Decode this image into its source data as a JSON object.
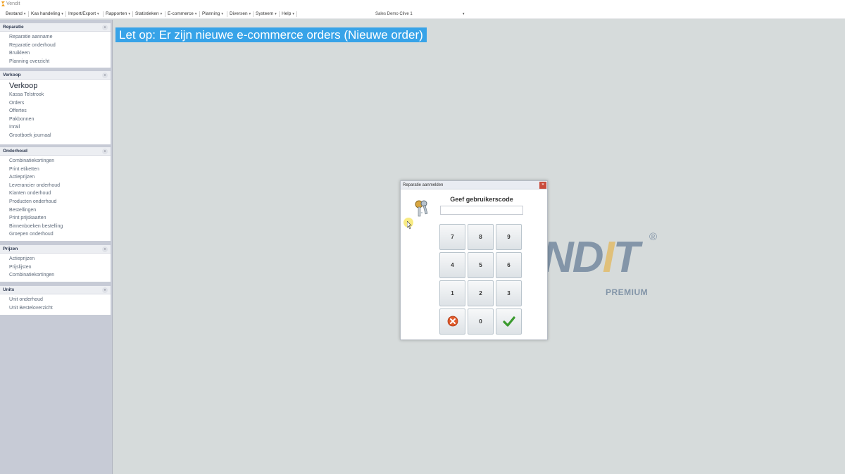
{
  "window": {
    "title": "Vendit"
  },
  "menubar": {
    "items": [
      {
        "label": "Bestand"
      },
      {
        "label": "Kas handeling"
      },
      {
        "label": "Import/Export"
      },
      {
        "label": "Rapporten"
      },
      {
        "label": "Statistieken"
      },
      {
        "label": "E-commerce"
      },
      {
        "label": "Planning"
      },
      {
        "label": "Diversen"
      },
      {
        "label": "Systeem"
      },
      {
        "label": "Help"
      }
    ],
    "store_selector": "Sales Demo Clive 1"
  },
  "sidebar": {
    "sections": [
      {
        "title": "Reparatie",
        "items": [
          "Reparatie aanname",
          "Reparatie onderhoud",
          "Bruikleen",
          "Planning overzicht"
        ]
      },
      {
        "title": "Verkoop",
        "highlight": "Verkoop",
        "items": [
          "Kassa Telstrook",
          "Orders",
          "Offertes",
          "Pakbonnen",
          "Inrail",
          "Grootboek journaal"
        ]
      },
      {
        "title": "Onderhoud",
        "items": [
          "Combinatiekortingen",
          "Print etiketten",
          "Actieprijzen",
          "Leverancier onderhoud",
          "Klanten onderhoud",
          "Producten onderhoud",
          "Bestellingen",
          "Print prijskaarten",
          "Binnenboeken bestelling",
          "Groepen onderhoud"
        ]
      },
      {
        "title": "Prijzen",
        "items": [
          "Actieprijzen",
          "Prijslijsten",
          "Combinatiekortingen"
        ]
      },
      {
        "title": "Units",
        "items": [
          "Unit onderhoud",
          "Unit Besteloverzicht"
        ]
      }
    ]
  },
  "banner": {
    "text": "Let op: Er zijn nieuwe e-commerce orders (Nieuwe order)"
  },
  "logo": {
    "text_main": "ND",
    "text_i": "I",
    "text_end": "T",
    "reg": "®",
    "sub": "PREMIUM"
  },
  "dialog": {
    "title": "Reparatie aanmelden",
    "close": "×",
    "prompt": "Geef gebruikerscode",
    "code_value": "",
    "keys": [
      "7",
      "8",
      "9",
      "4",
      "5",
      "6",
      "1",
      "2",
      "3",
      "cancel",
      "0",
      "ok"
    ]
  },
  "colors": {
    "banner": "#37a3e8",
    "sidebar_bg": "#c7cbd6",
    "workspace": "#d6dbdb",
    "ok": "#3a9a2e",
    "cancel": "#e05a2a"
  }
}
